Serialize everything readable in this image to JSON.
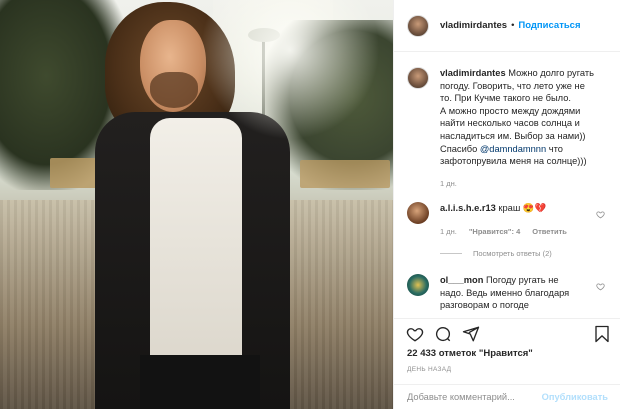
{
  "header": {
    "username": "vladimirdantes",
    "separator": "•",
    "follow_label": "Подписаться"
  },
  "caption": {
    "username": "vladimirdantes",
    "lines": [
      "Можно долго ругать",
      "погоду. Говорить, что лето уже не",
      "то. При Кучме такого не было.",
      "А можно просто между дождями",
      "найти несколько часов солнца и",
      "насладиться им. Выбор за нами))",
      "Спасибо",
      "@damndamnnn",
      "что",
      "зафотопрувила меня на солнце)))"
    ],
    "time": "1 дн."
  },
  "comments": [
    {
      "username": "a.l.i.s.h.e.r13",
      "text": "краш 😍💔",
      "time": "1 дн.",
      "likes": "\"Нравится\": 4",
      "reply": "Ответить",
      "view_replies": "Посмотреть ответы (2)"
    },
    {
      "username": "ol___mon",
      "lines": [
        "Погоду ругать не",
        "надо. Ведь именно благодаря",
        "разговорам о погоде"
      ]
    }
  ],
  "actions": {
    "icons": [
      "heart-icon",
      "comment-icon",
      "share-icon",
      "bookmark-icon"
    ]
  },
  "likes_text": "22 433 отметок \"Нравится\"",
  "date_text": "ДЕНЬ НАЗАД",
  "add_comment": {
    "placeholder": "Добавьте комментарий...",
    "publish_label": "Опубликовать"
  },
  "colors": {
    "link_blue": "#0095f6",
    "mention_blue": "#00376b",
    "muted_gray": "#8e8e8e",
    "disabled_publish": "#b2dffc",
    "heart_red": "#ed4956"
  }
}
